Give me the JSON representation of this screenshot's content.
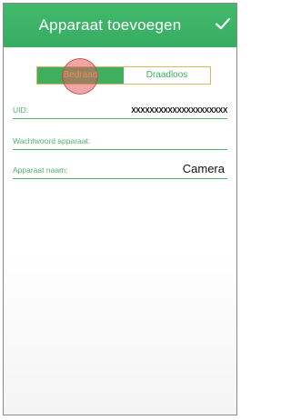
{
  "header": {
    "title": "Apparaat toevoegen",
    "confirm_icon": "check-icon"
  },
  "connection_type": {
    "options": [
      "Bedraad",
      "Draadloos"
    ],
    "selected": "Bedraad"
  },
  "form": {
    "uid": {
      "label": "UID:",
      "value": "XXXXXXXXXXXXXXXXXXXXX"
    },
    "password": {
      "label": "Wachtwoord apparaat:",
      "value": ""
    },
    "device_name": {
      "label": "Apparaat naam:",
      "value": "Camera"
    }
  },
  "colors": {
    "header": "#3cb371",
    "accent": "#4fb56c",
    "segment_border": "#d9b75a",
    "touch_indicator": "#e25c5c"
  }
}
